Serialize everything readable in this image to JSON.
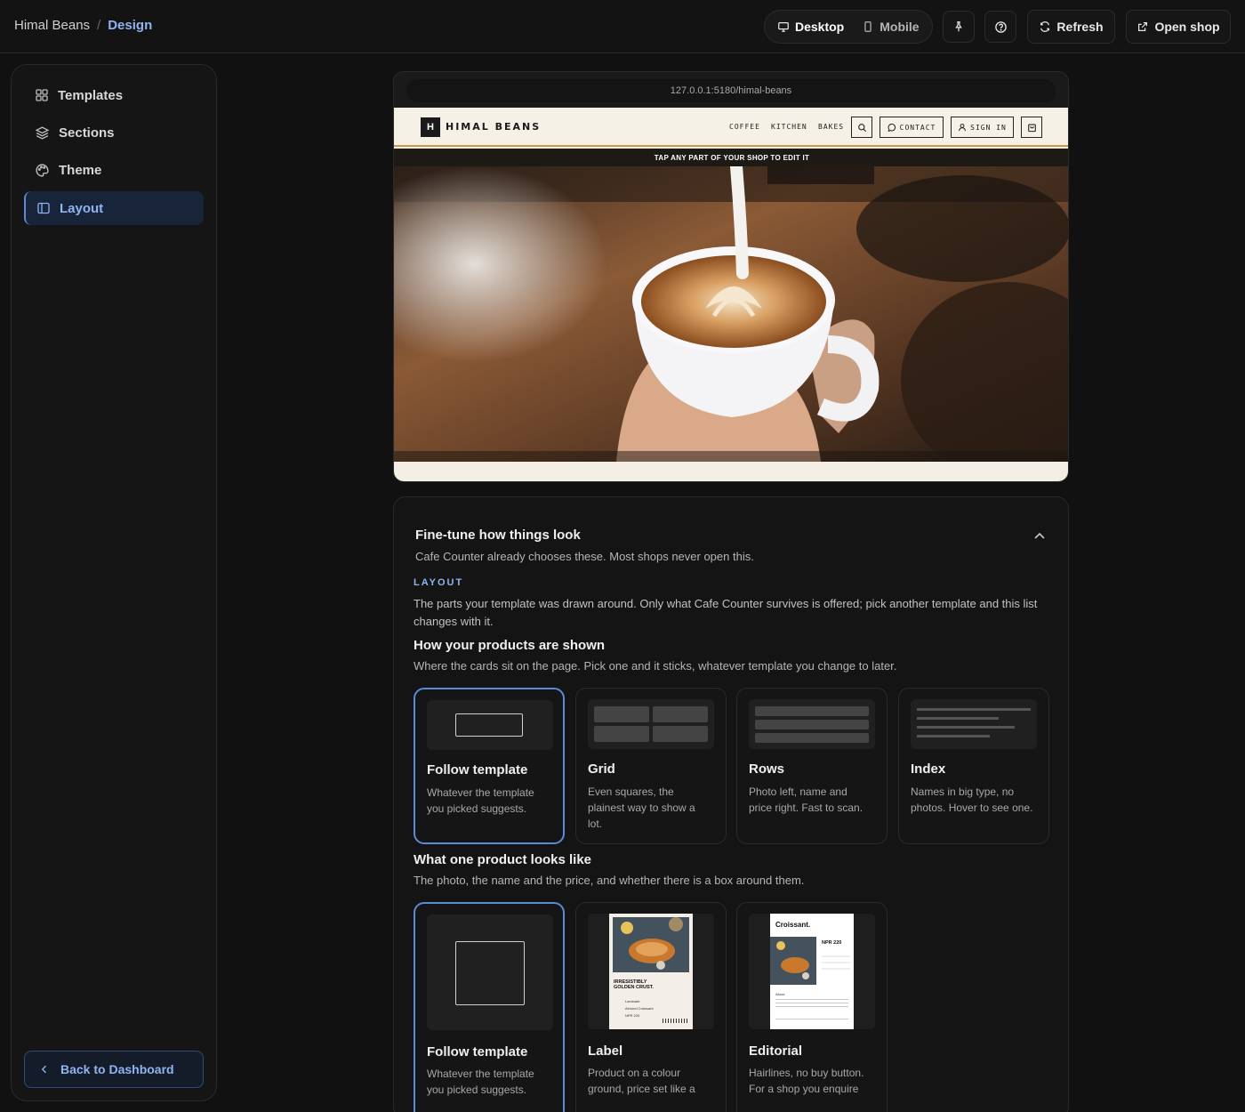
{
  "breadcrumb": {
    "shop": "Himal Beans",
    "separator": "/",
    "page": "Design"
  },
  "toolbar": {
    "desktop": "Desktop",
    "mobile": "Mobile",
    "refresh": "Refresh",
    "open_shop": "Open shop"
  },
  "sidebar": {
    "items": [
      {
        "label": "Templates",
        "icon": "grid-icon"
      },
      {
        "label": "Sections",
        "icon": "layers-icon"
      },
      {
        "label": "Theme",
        "icon": "palette-icon"
      },
      {
        "label": "Layout",
        "icon": "panel-icon",
        "active": true
      }
    ],
    "back": "Back to Dashboard"
  },
  "preview": {
    "url": "127.0.0.1:5180/himal-beans",
    "logo_letter": "H",
    "logo_text": "HIMAL BEANS",
    "nav": [
      "COFFEE",
      "KITCHEN",
      "BAKES"
    ],
    "contact": "CONTACT",
    "sign_in": "SIGN IN",
    "banner": "TAP ANY PART OF YOUR SHOP TO EDIT IT"
  },
  "panel": {
    "title": "Fine-tune how things look",
    "subtitle": "Cafe Counter already chooses these. Most shops never open this.",
    "kicker": "LAYOUT",
    "description": "The parts your template was drawn around. Only what Cafe Counter survives is offered; pick another template and this list changes with it.",
    "products_title": "How your products are shown",
    "products_sub": "Where the cards sit on the page. Pick one and it sticks, whatever template you change to later.",
    "product_options": [
      {
        "name": "Follow template",
        "desc": "Whatever the template you picked suggests."
      },
      {
        "name": "Grid",
        "desc": "Even squares, the plainest way to show a lot."
      },
      {
        "name": "Rows",
        "desc": "Photo left, name and price right. Fast to scan."
      },
      {
        "name": "Index",
        "desc": "Names in big type, no photos. Hover to see one."
      }
    ],
    "card_title": "What one product looks like",
    "card_sub": "The photo, the name and the price, and whether there is a box around them.",
    "card_options": [
      {
        "name": "Follow template",
        "desc": "Whatever the template you picked suggests."
      },
      {
        "name": "Label",
        "desc": "Product on a colour ground, price set like a"
      },
      {
        "name": "Editorial",
        "desc": "Hairlines, no buy button. For a shop you enquire"
      }
    ],
    "label_thumb": {
      "headline": "IRRESISTIBLY GOLDEN CRUST.",
      "name": "Almond Croissant",
      "type": "Laminate",
      "price": "NPR 220"
    },
    "editorial_thumb": {
      "title": "Croissant.",
      "price": "NPR 220",
      "about": "About"
    }
  },
  "colors": {
    "accent": "#8fb4f0",
    "accent_border": "#5b8ad8",
    "bg": "#111111",
    "panel": "#141414"
  }
}
